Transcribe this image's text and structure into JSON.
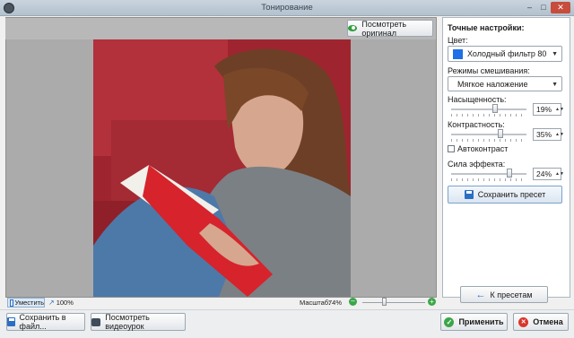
{
  "window": {
    "title": "Тонирование",
    "app_icon": "camera-lens-icon",
    "controls": [
      "minimize-icon",
      "maximize-icon",
      "close-icon"
    ]
  },
  "toolbar": {
    "view_original_label": "Посмотреть оригинал",
    "view_original_icon": "eye-icon"
  },
  "photo": {
    "description_icon": "photo-preview",
    "colors": {
      "wall": "#b2313a",
      "hair": "#6d3f26",
      "shirt": "#7b8085",
      "jeans": "#4d79a8",
      "book": "#d6232c",
      "skin": "#d7a68e",
      "background": "#ababab"
    }
  },
  "panel": {
    "heading": "Точные настройки:",
    "color_label": "Цвет:",
    "color_value": "Холодный фильтр 80",
    "color_swatch": "#1f6fe6",
    "blend_label": "Режимы смешивания:",
    "blend_value": "Мягкое наложение",
    "saturation_label": "Насыщенность:",
    "saturation_value": "19%",
    "saturation_level": 19,
    "contrast_label": "Контрастность:",
    "contrast_value": "35%",
    "contrast_level": 35,
    "autocontrast_label": "Автоконтраст",
    "autocontrast_checked": false,
    "effect_label": "Сила эффекта:",
    "effect_value": "24%",
    "effect_level": 24,
    "save_preset_label": "Сохранить пресет",
    "save_preset_icon": "floppy-disk-icon",
    "back_to_presets_label": "К пресетам",
    "back_icon": "arrow-left-icon"
  },
  "status": {
    "fit_label": "Уместить",
    "fit_icon": "fit-screen-icon",
    "actual_size_label": "100%",
    "actual_size_icon": "actual-size-icon",
    "scale_label": "Масштаб:",
    "scale_value": "74%",
    "zoom_level": 74,
    "zoom_out_icon": "zoom-out-icon",
    "zoom_in_icon": "zoom-in-icon"
  },
  "bottom": {
    "save_file_label": "Сохранить в файл...",
    "save_file_icon": "floppy-disk-icon",
    "watch_video_label": "Посмотреть видеоурок",
    "watch_video_icon": "video-camera-icon",
    "apply_label": "Применить",
    "apply_icon": "check-icon",
    "cancel_label": "Отмена",
    "cancel_icon": "cancel-icon"
  }
}
